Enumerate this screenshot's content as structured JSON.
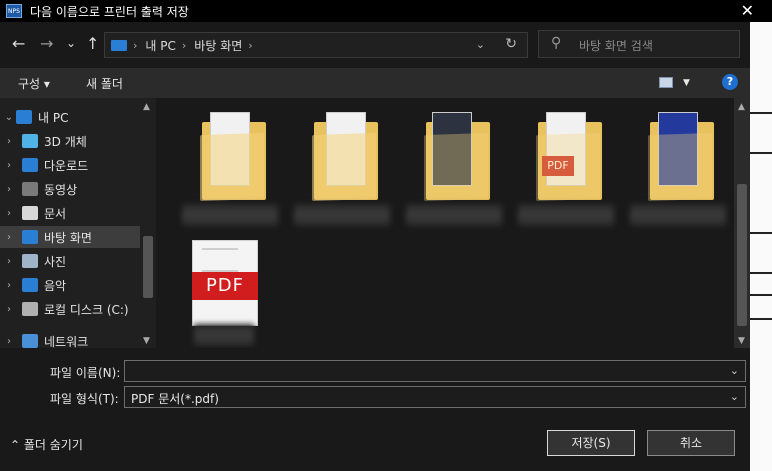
{
  "window": {
    "title": "다음 이름으로 프린터 출력 저장",
    "close": "✕"
  },
  "nav": {
    "back": "←",
    "forward": "→",
    "history": "⌄",
    "up": "↑",
    "breadcrumb": [
      "내 PC",
      "바탕 화면"
    ],
    "sep": "›",
    "dropdown": "⌄",
    "refresh": "↻",
    "search_placeholder": "바탕 화면 검색"
  },
  "toolbar": {
    "organize": "구성 ▾",
    "new_folder": "새 폴더",
    "help": "?"
  },
  "sidebar": {
    "items": [
      {
        "label": "내 PC",
        "chevron": "⌄",
        "icon": "pc-icon",
        "color": "#2a7fd4"
      },
      {
        "label": "3D 개체",
        "chevron": "›",
        "icon": "3d-objects-icon",
        "color": "#4fb3e8"
      },
      {
        "label": "다운로드",
        "chevron": "›",
        "icon": "download-icon",
        "color": "#2a7fd4"
      },
      {
        "label": "동영상",
        "chevron": "›",
        "icon": "video-icon",
        "color": "#7a7a7a"
      },
      {
        "label": "문서",
        "chevron": "›",
        "icon": "documents-icon",
        "color": "#d8d8d8"
      },
      {
        "label": "바탕 화면",
        "chevron": "›",
        "icon": "desktop-icon",
        "color": "#2a7fd4"
      },
      {
        "label": "사진",
        "chevron": "›",
        "icon": "pictures-icon",
        "color": "#9fb4c8"
      },
      {
        "label": "음악",
        "chevron": "›",
        "icon": "music-icon",
        "color": "#2a7fd4"
      },
      {
        "label": "로컬 디스크 (C:)",
        "chevron": "›",
        "icon": "disk-icon",
        "color": "#b0b0b0"
      },
      {
        "label": "네트워크",
        "chevron": "›",
        "icon": "network-icon",
        "color": "#4a90d9"
      }
    ],
    "selected_index": 5
  },
  "files": [
    {
      "type": "folder",
      "thumb": "light"
    },
    {
      "type": "folder",
      "thumb": "light"
    },
    {
      "type": "folder",
      "thumb": "dark"
    },
    {
      "type": "folder",
      "thumb": "pdf",
      "pdf_text": "PDF"
    },
    {
      "type": "folder",
      "thumb": "blue"
    },
    {
      "type": "pdf",
      "pdf_text": "PDF"
    }
  ],
  "form": {
    "filename_label": "파일 이름(N):",
    "filename_value": "",
    "filetype_label": "파일 형식(T):",
    "filetype_value": "PDF 문서(*.pdf)",
    "chevron": "⌄",
    "hide_folders": "⌃ 폴더 숨기기",
    "save": "저장(S)",
    "cancel": "취소"
  }
}
